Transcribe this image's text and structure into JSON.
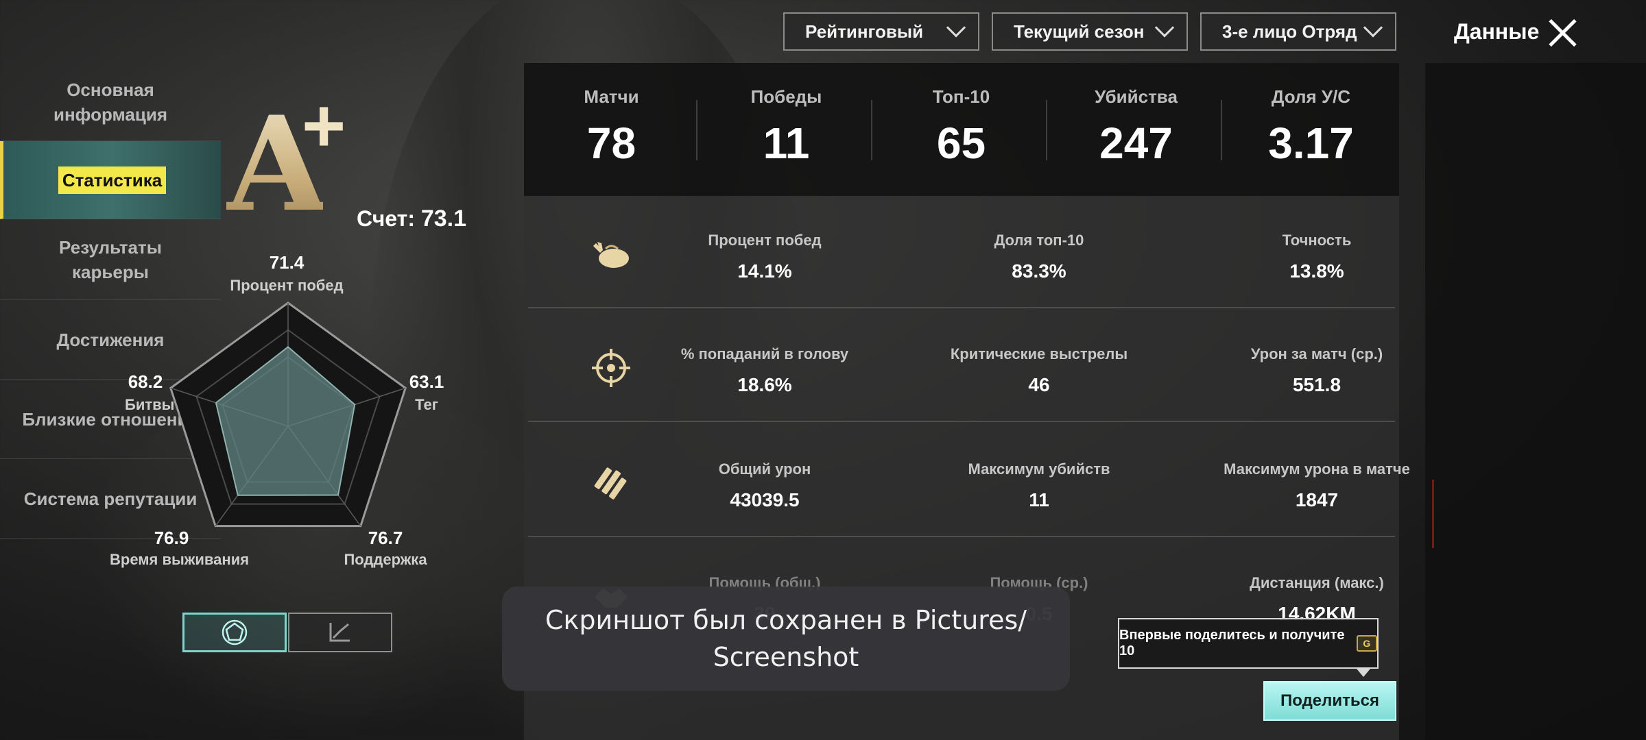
{
  "filters": {
    "mode": "Рейтинговый",
    "season": "Текущий сезон",
    "team": "3-е лицо Отряд"
  },
  "header": {
    "title": "Данные"
  },
  "sidebar": {
    "items": [
      {
        "label": "Основная информация"
      },
      {
        "label": "Статистика"
      },
      {
        "label": "Результаты карьеры"
      },
      {
        "label": "Достижения"
      },
      {
        "label": "Близкие отношения"
      },
      {
        "label": "Система репутации"
      }
    ],
    "active_index": 1
  },
  "grade": {
    "letter": "A",
    "modifier": "+",
    "score_label": "Счет:",
    "score_value": "73.1"
  },
  "radar": {
    "axes": [
      {
        "label": "Процент побед",
        "value": "71.4"
      },
      {
        "label": "Тег",
        "value": "63.1"
      },
      {
        "label": "Поддержка",
        "value": "76.7"
      },
      {
        "label": "Время выживания",
        "value": "76.9"
      },
      {
        "label": "Битвы",
        "value": "68.2"
      }
    ],
    "max": 100
  },
  "summary": {
    "cells": [
      {
        "label": "Матчи",
        "value": "78"
      },
      {
        "label": "Победы",
        "value": "11"
      },
      {
        "label": "Топ-10",
        "value": "65"
      },
      {
        "label": "Убийства",
        "value": "247"
      },
      {
        "label": "Доля У/С",
        "value": "3.17"
      }
    ]
  },
  "metrics": {
    "rows": [
      {
        "icon": "chicken-icon",
        "items": [
          {
            "label": "Процент побед",
            "value": "14.1%"
          },
          {
            "label": "Доля топ-10",
            "value": "83.3%"
          },
          {
            "label": "Точность",
            "value": "13.8%"
          }
        ]
      },
      {
        "icon": "crosshair-icon",
        "items": [
          {
            "label": "% попаданий в голову",
            "value": "18.6%"
          },
          {
            "label": "Критические выстрелы",
            "value": "46"
          },
          {
            "label": "Урон за матч (ср.)",
            "value": "551.8"
          }
        ]
      },
      {
        "icon": "ammo-icon",
        "items": [
          {
            "label": "Общий урон",
            "value": "43039.5"
          },
          {
            "label": "Максимум убийств",
            "value": "11"
          },
          {
            "label": "Максимум урона в матче",
            "value": "1847"
          }
        ]
      },
      {
        "icon": "handshake-icon",
        "items": [
          {
            "label": "Помощь (общ.)",
            "value": "39"
          },
          {
            "label": "Помощь (ср.)",
            "value": "0.5"
          },
          {
            "label": "Дистанция (макс.)",
            "value": "14.62KM"
          }
        ]
      }
    ]
  },
  "share": {
    "tip": "Впервые поделитесь и получите 10",
    "coin_symbol": "G",
    "button": "Поделиться"
  },
  "toast": {
    "text": "Скриншот был сохранен в  Pictures/ Screenshot"
  }
}
